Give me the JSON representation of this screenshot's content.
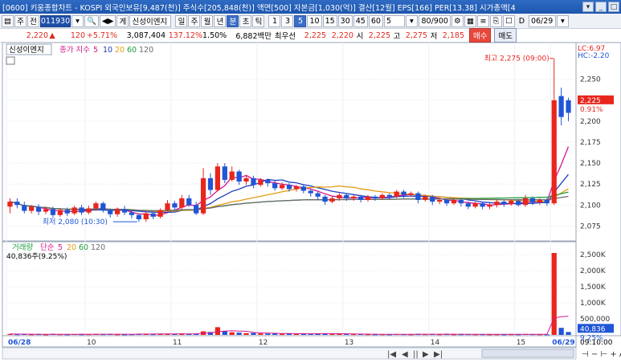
{
  "window": {
    "title": "[0600] 키움종합차트 - KOSPI 외국인보유[9,487(천)] 주식수[205,848(천)] 액면[500] 자본금[1,030(억)] 결산[12월] EPS[166] PER[13.38] 시가총액[4"
  },
  "toolbar": {
    "menu_icon": "▤",
    "period": "주",
    "scope": "전",
    "code": "011930",
    "search": "🔍",
    "arrow": "◀▶",
    "mode": "게",
    "name": "신성이엔지",
    "units": [
      "일",
      "주",
      "월",
      "년",
      "분",
      "초",
      "틱"
    ],
    "active_unit": "분",
    "minutes": [
      "1",
      "3",
      "5",
      "10",
      "15",
      "30",
      "45",
      "60"
    ],
    "active_minute": "5",
    "count": "5",
    "view_count": "80/900",
    "d_label": "D",
    "date": "06/29"
  },
  "info": {
    "price": "2,220",
    "change": "120",
    "change_pct": "+5.71%",
    "volume": "3,087,404",
    "vol_ratio": "137.12%",
    "turnover": "1.50%",
    "amount": "6,882백만",
    "best_label": "최우선",
    "bid": "2,225",
    "ask": "2,220",
    "open_label": "시",
    "open": "2,225",
    "high_label": "고",
    "high": "2,275",
    "low_label": "저",
    "low": "2,185",
    "buy_label": "매수",
    "sell_label": "매도"
  },
  "price_panel": {
    "legend_name": "신성이엔지",
    "legend_ma": "종가 지수",
    "ma_periods": [
      "5",
      "10",
      "20",
      "60",
      "120"
    ],
    "ma_colors": [
      "#d6178f",
      "#1d3fbf",
      "#e49b10",
      "#1e9d3f",
      "#6a6a6a"
    ],
    "lc": "LC:6.97",
    "hc": "HC:-2.20",
    "max_label": "최고 2,275 (09:00)",
    "min_label": "최저 2,080 (10:30)",
    "current_price": "2,225",
    "current_pct": "0.91%",
    "yticks": [
      "2,250",
      "2,225",
      "2,200",
      "2,175",
      "2,150",
      "2,125",
      "2,100",
      "2,075"
    ]
  },
  "volume_panel": {
    "legend_name": "거래량",
    "legend_ma": "단순",
    "ma_periods": [
      "5",
      "20",
      "60",
      "120"
    ],
    "value_label": "40,836주(9.25%)",
    "current_volume": "40,836",
    "current_pct": "9.25%",
    "yticks": [
      "2,500K",
      "2,000K",
      "1,500K",
      "1,000K",
      "500,000"
    ]
  },
  "xaxis": {
    "labels": [
      "06/28",
      "10",
      "11",
      "12",
      "13",
      "14",
      "15",
      "06/29"
    ],
    "time": "09:10:00",
    "zoom": "⊣ − ⊢ + A"
  },
  "colors": {
    "up": "#e8261d",
    "down": "#1f55d6",
    "ma5": "#d6178f",
    "ma10": "#1d3fbf",
    "ma20": "#e49b10",
    "ma60": "#1e9d3f",
    "ma120": "#6a6a6a"
  },
  "chart_data": {
    "type": "candlestick",
    "price_range": [
      2060,
      2290
    ],
    "volume_range": [
      0,
      2800
    ],
    "x_dates": [
      "06/28",
      "06/29"
    ],
    "candles": [
      [
        2098,
        2104,
        2090,
        2108,
        30
      ],
      [
        2104,
        2100,
        2096,
        2108,
        20
      ],
      [
        2100,
        2093,
        2090,
        2104,
        25
      ],
      [
        2093,
        2098,
        2090,
        2100,
        18
      ],
      [
        2098,
        2092,
        2088,
        2101,
        22
      ],
      [
        2092,
        2095,
        2089,
        2098,
        15
      ],
      [
        2095,
        2088,
        2085,
        2098,
        28
      ],
      [
        2088,
        2094,
        2086,
        2096,
        20
      ],
      [
        2094,
        2090,
        2087,
        2097,
        17
      ],
      [
        2090,
        2097,
        2088,
        2099,
        24
      ],
      [
        2097,
        2091,
        2088,
        2100,
        19
      ],
      [
        2091,
        2096,
        2089,
        2099,
        21
      ],
      [
        2096,
        2102,
        2093,
        2104,
        26
      ],
      [
        2102,
        2094,
        2091,
        2104,
        22
      ],
      [
        2094,
        2089,
        2085,
        2096,
        30
      ],
      [
        2089,
        2095,
        2086,
        2097,
        18
      ],
      [
        2095,
        2091,
        2088,
        2099,
        16
      ],
      [
        2091,
        2088,
        2084,
        2093,
        20
      ],
      [
        2088,
        2083,
        2080,
        2090,
        35
      ],
      [
        2083,
        2090,
        2080,
        2092,
        40
      ],
      [
        2090,
        2086,
        2083,
        2092,
        22
      ],
      [
        2086,
        2094,
        2084,
        2096,
        30
      ],
      [
        2094,
        2102,
        2092,
        2106,
        38
      ],
      [
        2102,
        2097,
        2094,
        2105,
        25
      ],
      [
        2097,
        2108,
        2095,
        2112,
        45
      ],
      [
        2108,
        2100,
        2098,
        2112,
        30
      ],
      [
        2100,
        2090,
        2088,
        2104,
        40
      ],
      [
        2090,
        2132,
        2088,
        2144,
        110
      ],
      [
        2132,
        2118,
        2112,
        2138,
        90
      ],
      [
        2118,
        2146,
        2116,
        2150,
        240
      ],
      [
        2146,
        2130,
        2126,
        2150,
        120
      ],
      [
        2130,
        2140,
        2128,
        2146,
        80
      ],
      [
        2140,
        2128,
        2124,
        2142,
        70
      ],
      [
        2128,
        2132,
        2124,
        2136,
        55
      ],
      [
        2132,
        2124,
        2120,
        2135,
        60
      ],
      [
        2124,
        2130,
        2122,
        2132,
        45
      ],
      [
        2130,
        2126,
        2122,
        2131,
        40
      ],
      [
        2126,
        2120,
        2117,
        2129,
        50
      ],
      [
        2120,
        2124,
        2118,
        2127,
        35
      ],
      [
        2124,
        2119,
        2116,
        2126,
        38
      ],
      [
        2119,
        2122,
        2116,
        2124,
        30
      ],
      [
        2122,
        2117,
        2114,
        2124,
        34
      ],
      [
        2117,
        2114,
        2110,
        2119,
        40
      ],
      [
        2114,
        2110,
        2106,
        2116,
        45
      ],
      [
        2110,
        2104,
        2100,
        2112,
        50
      ],
      [
        2104,
        2108,
        2102,
        2110,
        30
      ],
      [
        2108,
        2112,
        2105,
        2114,
        28
      ],
      [
        2112,
        2108,
        2105,
        2114,
        26
      ],
      [
        2108,
        2110,
        2105,
        2112,
        22
      ],
      [
        2110,
        2106,
        2103,
        2112,
        24
      ],
      [
        2106,
        2110,
        2104,
        2112,
        20
      ],
      [
        2110,
        2108,
        2105,
        2112,
        18
      ],
      [
        2108,
        2112,
        2106,
        2114,
        20
      ],
      [
        2112,
        2110,
        2107,
        2114,
        17
      ],
      [
        2110,
        2116,
        2108,
        2118,
        25
      ],
      [
        2116,
        2112,
        2108,
        2118,
        22
      ],
      [
        2112,
        2114,
        2110,
        2116,
        18
      ],
      [
        2114,
        2106,
        2102,
        2116,
        30
      ],
      [
        2106,
        2110,
        2104,
        2112,
        22
      ],
      [
        2110,
        2104,
        2100,
        2112,
        26
      ],
      [
        2104,
        2106,
        2101,
        2108,
        20
      ],
      [
        2106,
        2102,
        2099,
        2108,
        24
      ],
      [
        2102,
        2106,
        2100,
        2108,
        18
      ],
      [
        2106,
        2102,
        2098,
        2108,
        20
      ],
      [
        2102,
        2098,
        2095,
        2104,
        22
      ],
      [
        2098,
        2102,
        2096,
        2104,
        18
      ],
      [
        2102,
        2098,
        2095,
        2104,
        20
      ],
      [
        2098,
        2100,
        2095,
        2102,
        16
      ],
      [
        2100,
        2104,
        2097,
        2106,
        18
      ],
      [
        2104,
        2101,
        2098,
        2106,
        16
      ],
      [
        2101,
        2105,
        2099,
        2107,
        20
      ],
      [
        2105,
        2100,
        2098,
        2107,
        18
      ],
      [
        2100,
        2108,
        2098,
        2112,
        26
      ],
      [
        2108,
        2103,
        2100,
        2110,
        22
      ],
      [
        2103,
        2106,
        2100,
        2108,
        18
      ],
      [
        2106,
        2102,
        2099,
        2108,
        16
      ],
      [
        2102,
        2225,
        2100,
        2275,
        2550
      ],
      [
        2230,
        2205,
        2195,
        2240,
        220
      ],
      [
        2225,
        2210,
        2200,
        2228,
        90
      ]
    ]
  }
}
